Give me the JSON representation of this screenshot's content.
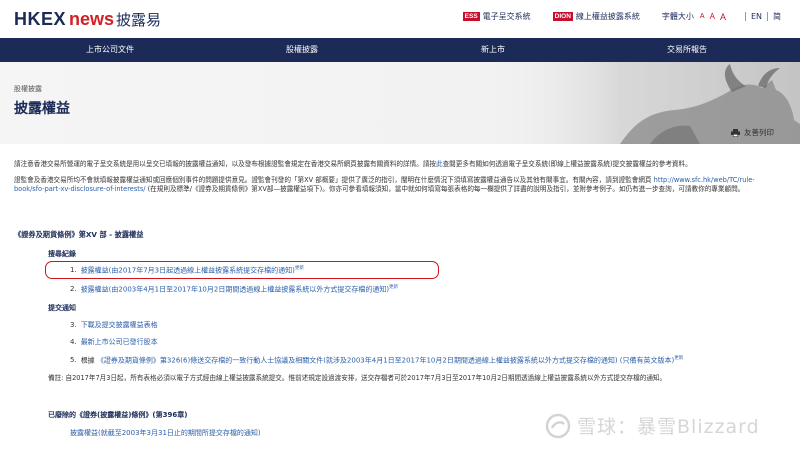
{
  "header": {
    "logo_hkex": "HKEX",
    "logo_news": "news",
    "logo_cn": "披露易",
    "links": [
      {
        "badge": "ESS",
        "label": "電子呈交系統"
      },
      {
        "badge": "DION",
        "label": "線上權益披露系統"
      }
    ],
    "font_size_label": "字體大小",
    "font_sizes": [
      "A",
      "A",
      "A"
    ],
    "languages": [
      "EN",
      "简"
    ]
  },
  "nav": {
    "items": [
      "上市公司文件",
      "股權披露",
      "新上市",
      "交易所報告"
    ]
  },
  "hero": {
    "breadcrumb": "股權披露",
    "title": "披露權益",
    "print_label": "友善列印"
  },
  "intro": {
    "para1": "請注意香港交易所營運的電子呈交系統是用以呈交已填報的披露權益通知，以及發布根據證監會規定在香港交易所網頁披露有關資料的詳情。請按",
    "para1_link": "此",
    "para1_rest": "查閱更多有關如何透過電子呈交系統(即線上權益披露系統)提交披露權益的參考資料。",
    "para2": "證監會及香港交易所均不會就填報披露權益通知或回應個別事件的問題提供意見。證監會刊發的「第XV 部概要」提供了廣泛的指引，闡明在什麼情況下須填寫披露權益通告以及其他有關事宜。有關內容，請到證監會網頁",
    "para2_link": "http://www.sfc.hk/web/TC/rule-book/sfo-part-xv-disclosure-of-interests/",
    "para2_rest": " (在規則及標準/《證券及期貨條例》第XV部—披露權益項下)。你亦可參看填報須知，當中就如何填寫每張表格的每一欄提供了詳盡的說明及指引，並附參考例子。如仍有進一步查詢，可請教你的專業顧問。"
  },
  "section": {
    "title": "《證券及期貨條例》第XV 部 - 披露權益",
    "reporting_heading": "搜尋紀錄",
    "reporting_items": [
      {
        "num": "1.",
        "label": "披露權益(由2017年7月3日起透過線上權益披露系統提交存檔的通知)",
        "tag": "更新"
      },
      {
        "num": "2.",
        "label": "披露權益(由2003年4月1日至2017年10月2日期間透過線上權益披露系統以外方式提交存檔的通知)",
        "tag": "更新"
      }
    ],
    "submission_heading": "提交通知",
    "submission_items": [
      {
        "num": "3.",
        "label": "下載及提交披露權益表格"
      },
      {
        "num": "4.",
        "label": "最新上市公司已發行股本"
      },
      {
        "num": "5.",
        "prefix": "根據 ",
        "label": "《證券及期貨條例》第326(6)條送交存檔的一致行動人士協議及相關文件(就涉及2003年4月1日至2017年10月2日期間透過線上權益披露系統以外方式提交存檔的通知) (只備有英文版本)",
        "tag": "更新"
      }
    ],
    "note": "備註: 自2017年7月3日起，所有表格必須以電子方式經由線上權益披露系統提交。惟前述規定設過渡安排，送交存檔者可於2017年7月3日至2017年10月2日期間透過線上權益披露系統以外方式提交存檔的通知。",
    "repealed_heading": "已廢除的《證券(披露權益)條例》(第396章)",
    "repealed_item": "披露權益(就截至2003年3月31日止的期間所提交存檔的通知)"
  },
  "watermark": {
    "text": "雪球：暴雪Blizzard"
  },
  "colors": {
    "brand_navy": "#1b2a57",
    "brand_red": "#d31f26",
    "link_blue": "#2a5ea8",
    "highlight_red": "#d0141c"
  }
}
